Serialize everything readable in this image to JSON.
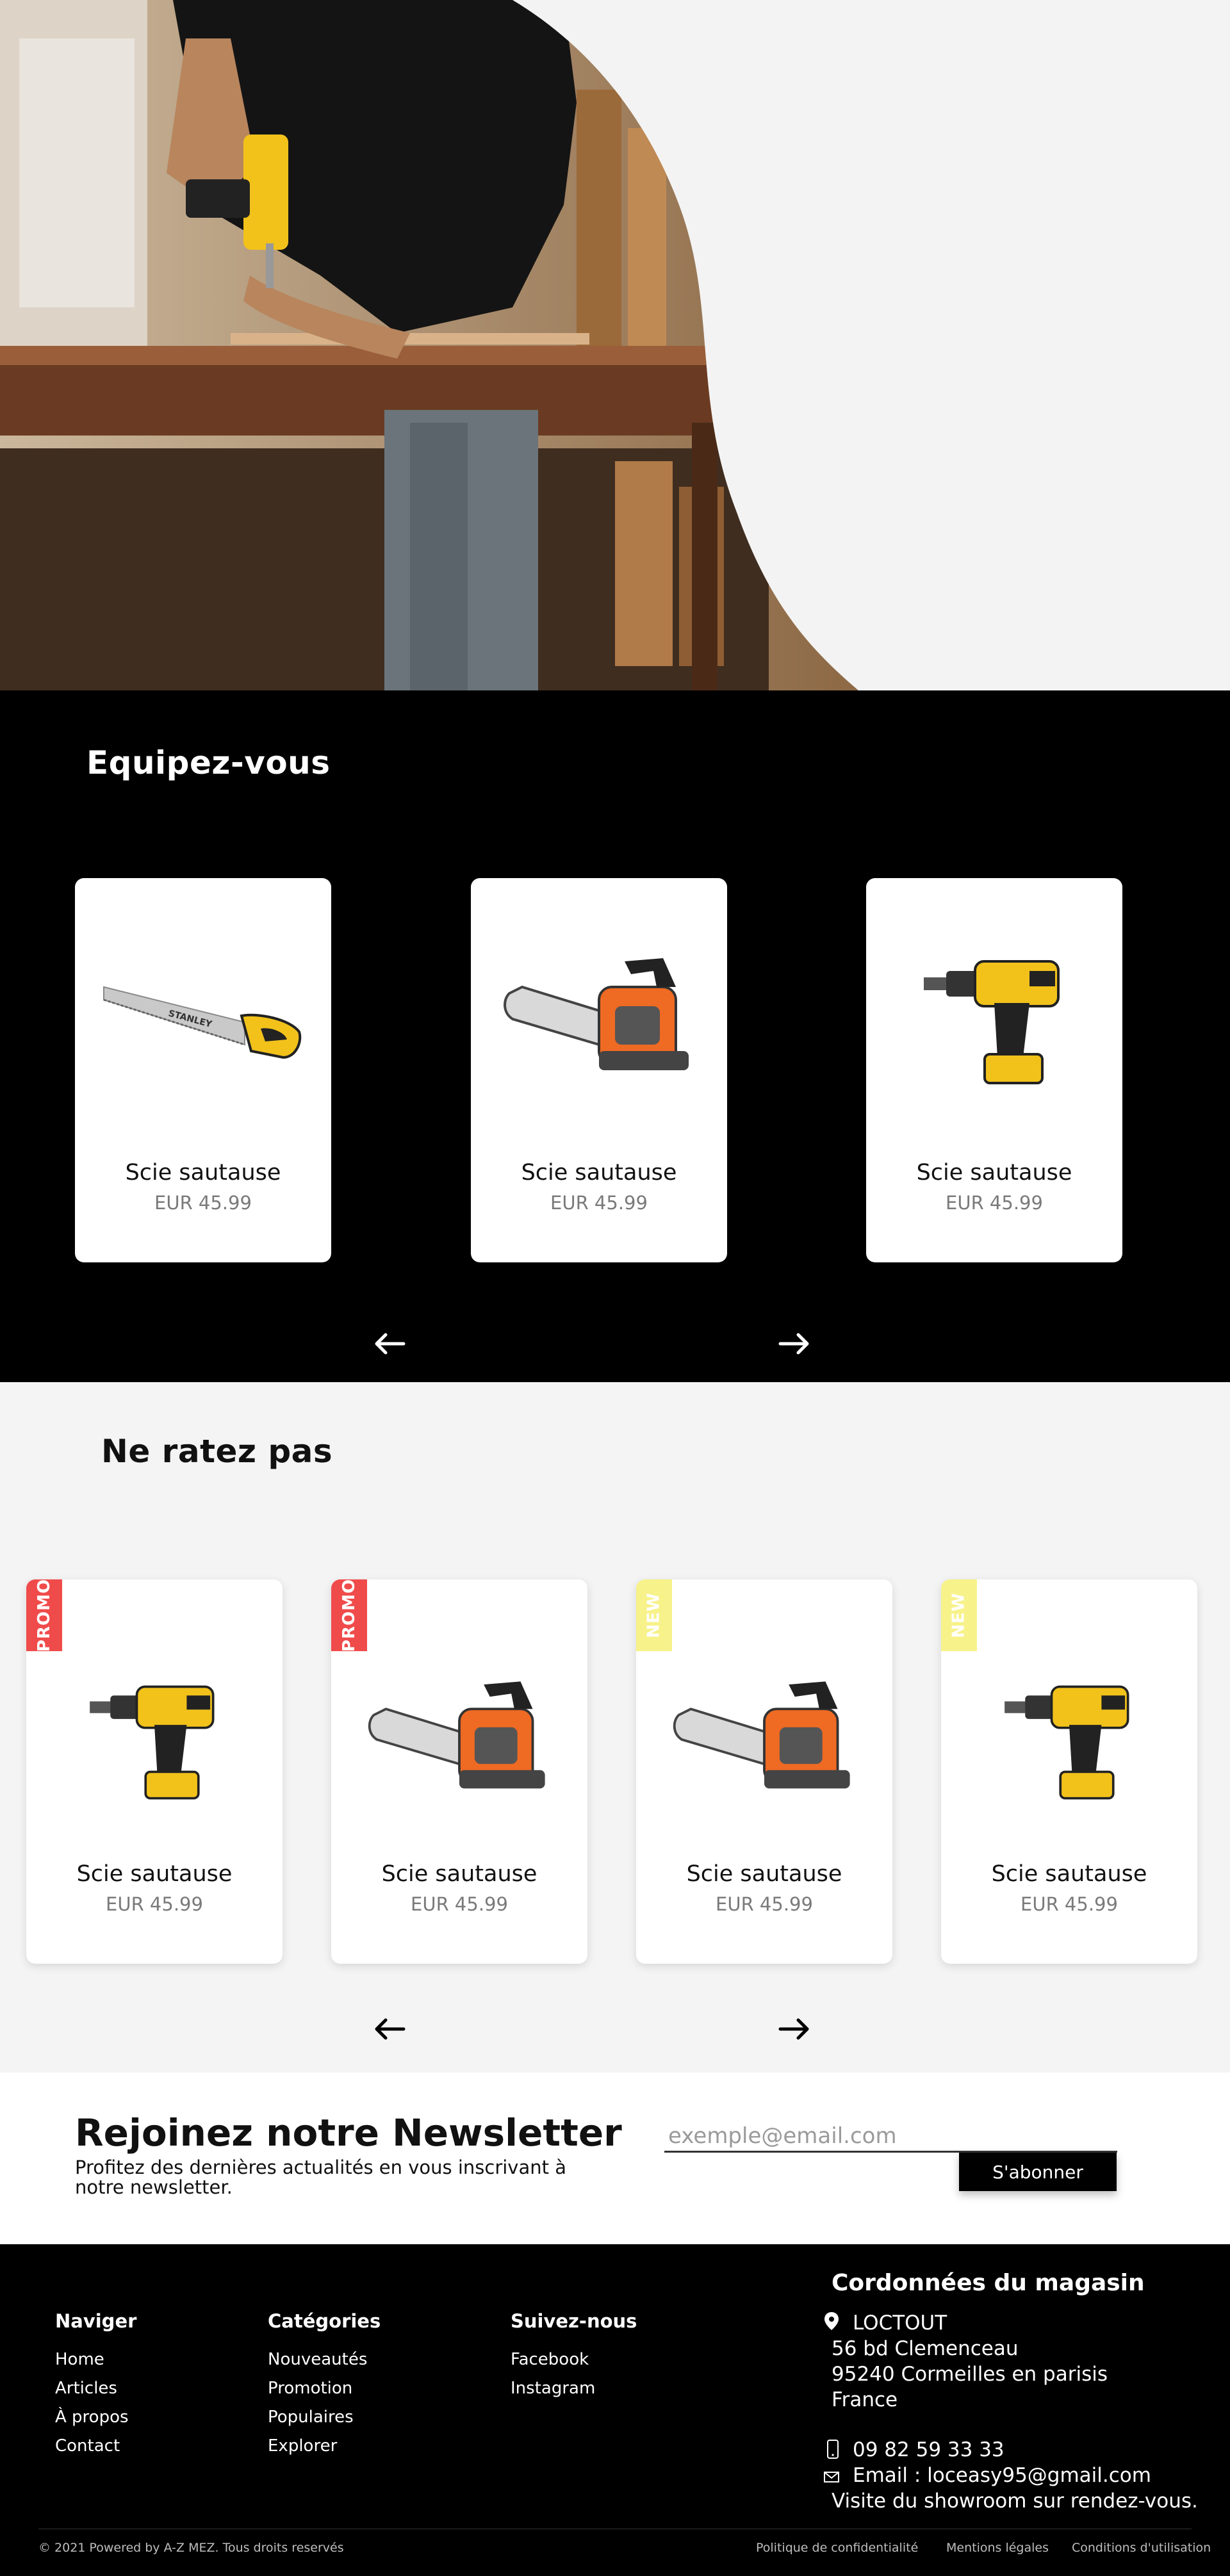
{
  "hero": {},
  "equip": {
    "title": "Equipez-vous",
    "products": [
      {
        "name": "Scie sautause",
        "price": "EUR 45.99",
        "icon": "handsaw-icon"
      },
      {
        "name": "Scie sautause",
        "price": "EUR 45.99",
        "icon": "chainsaw-icon"
      },
      {
        "name": "Scie sautause",
        "price": "EUR 45.99",
        "icon": "drill-icon"
      }
    ]
  },
  "missed": {
    "title": "Ne ratez pas",
    "products": [
      {
        "badge": "PROMO",
        "name": "Scie sautause",
        "price": "EUR 45.99",
        "icon": "drill-icon"
      },
      {
        "badge": "PROMO",
        "name": "Scie sautause",
        "price": "EUR 45.99",
        "icon": "chainsaw-icon"
      },
      {
        "badge": "NEW",
        "name": "Scie sautause",
        "price": "EUR 45.99",
        "icon": "chainsaw-icon"
      },
      {
        "badge": "NEW",
        "name": "Scie sautause",
        "price": "EUR 45.99",
        "icon": "drill-icon"
      }
    ]
  },
  "newsletter": {
    "title": "Rejoinez notre Newsletter",
    "subtitle": "Profitez des dernières actualités en vous inscrivant à notre newsletter.",
    "placeholder": "exemple@email.com",
    "button": "S'abonner"
  },
  "footer": {
    "nav": {
      "title": "Naviger",
      "items": [
        "Home",
        "Articles",
        "À propos",
        "Contact"
      ]
    },
    "categories": {
      "title": "Catégories",
      "items": [
        "Nouveautés",
        "Promotion",
        "Populaires",
        "Explorer"
      ]
    },
    "social": {
      "title": "Suivez-nous",
      "items": [
        "Facebook",
        "Instagram"
      ]
    },
    "contact": {
      "title": "Cordonnées du magasin",
      "name": "LOCTOUT",
      "street": "56 bd Clemenceau",
      "city": "95240 Cormeilles en parisis",
      "country": "France",
      "phone": "09 82 59 33 33",
      "email": "Email : loceasy95@gmail.com",
      "note": "Visite du showroom sur rendez-vous."
    },
    "copyright": "© 2021 Powered by A-Z MEZ. Tous droits reservés",
    "legal": [
      "Politique de confidentialité",
      "Mentions légales",
      "Conditions d'utilisation"
    ]
  },
  "colors": {
    "promo": "#f04b4b",
    "new": "#f7f28a",
    "accent_yellow": "#f2c21b",
    "chainsaw_orange": "#ef6a23"
  }
}
